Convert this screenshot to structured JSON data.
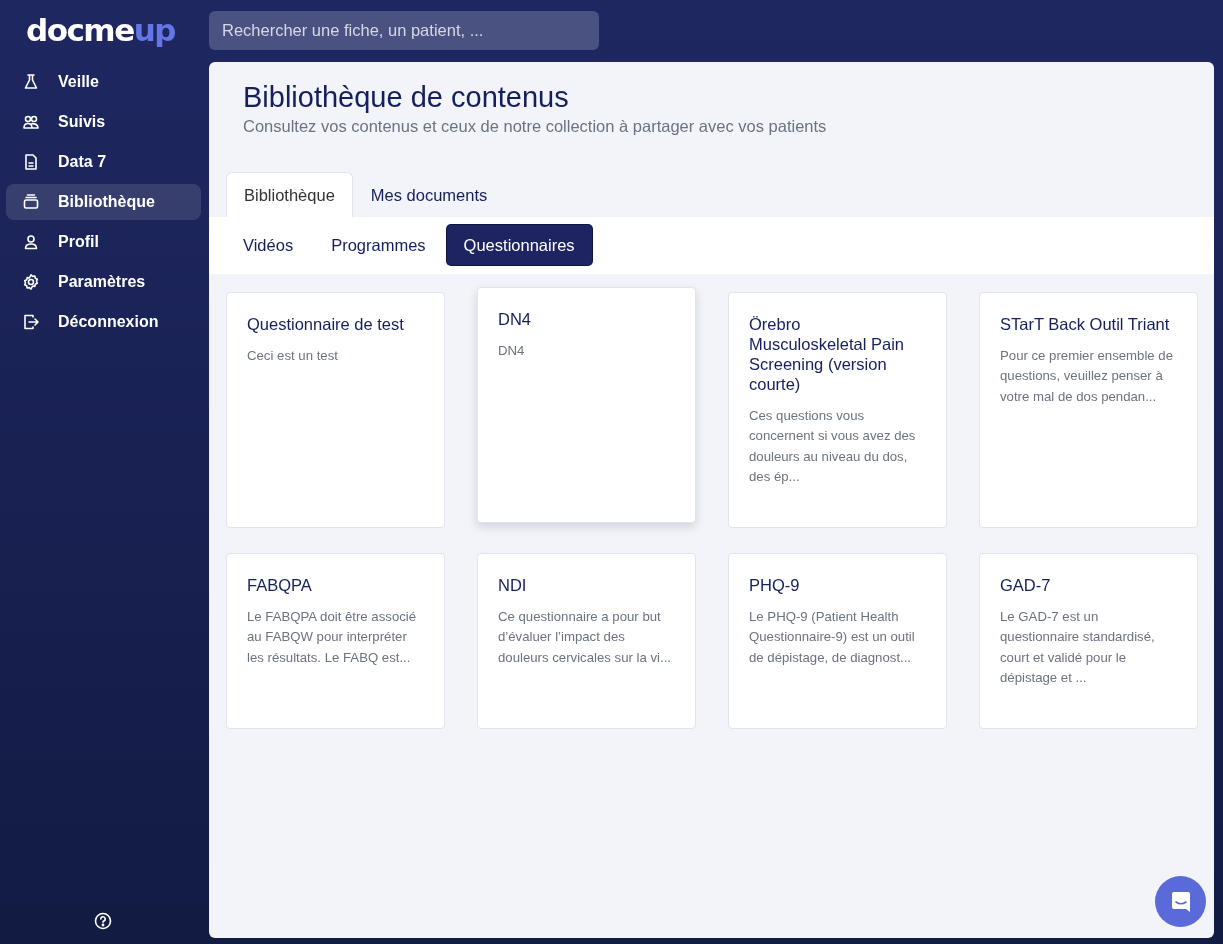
{
  "logo": {
    "main": "docme",
    "accent": "up"
  },
  "search": {
    "placeholder": "Rechercher une fiche, un patient, ..."
  },
  "sidebar": {
    "items": [
      {
        "label": "Veille",
        "selected": false
      },
      {
        "label": "Suivis",
        "selected": false
      },
      {
        "label": "Data 7",
        "selected": false
      },
      {
        "label": "Bibliothèque",
        "selected": true
      },
      {
        "label": "Profil",
        "selected": false
      },
      {
        "label": "Paramètres",
        "selected": false
      },
      {
        "label": "Déconnexion",
        "selected": false
      }
    ]
  },
  "page": {
    "title": "Bibliothèque de contenus",
    "subtitle": "Consultez vos contenus et ceux de notre collection à partager avec vos patients"
  },
  "tabs": [
    {
      "label": "Bibliothèque",
      "selected": true
    },
    {
      "label": "Mes documents",
      "selected": false
    }
  ],
  "subtabs": [
    {
      "label": "Vidéos",
      "selected": false
    },
    {
      "label": "Programmes",
      "selected": false
    },
    {
      "label": "Questionnaires",
      "selected": true
    }
  ],
  "cards": [
    {
      "title": "Questionnaire de test",
      "description": "Ceci est un test",
      "hovered": false
    },
    {
      "title": "DN4",
      "description": "DN4",
      "hovered": true
    },
    {
      "title": "Örebro Musculoskeletal Pain Screening (version courte)",
      "description": "Ces questions vous concernent si vous avez des douleurs au niveau du dos, des ép...",
      "hovered": false
    },
    {
      "title": "STarT Back Outil Triant",
      "description": "Pour ce premier ensemble de questions, veuillez penser à votre mal de dos pendan...",
      "hovered": false
    },
    {
      "title": "FABQPA",
      "description": "Le FABQPA doit être associé au FABQW pour interpréter les résultats. Le FABQ est...",
      "hovered": false
    },
    {
      "title": "NDI",
      "description": "Ce questionnaire a pour but d’évaluer l’impact des douleurs cervicales sur la vi...",
      "hovered": false
    },
    {
      "title": "PHQ-9",
      "description": "Le PHQ-9 (Patient Health Questionnaire-9) est un outil de dépistage, de diagnost...",
      "hovered": false
    },
    {
      "title": "GAD-7",
      "description": "Le GAD-7 est un questionnaire standardisé, court et validé pour le dépistage et ...",
      "hovered": false
    }
  ]
}
